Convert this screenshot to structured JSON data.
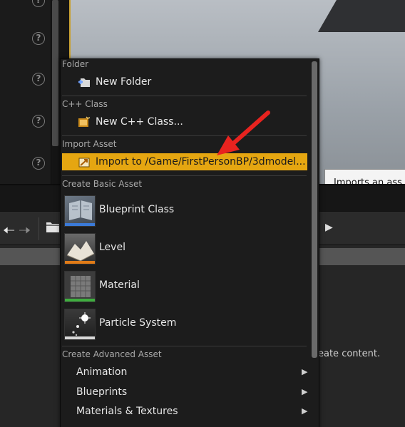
{
  "context_menu": {
    "sections": [
      {
        "header": "Folder",
        "items": [
          {
            "label": "New Folder",
            "icon": "new-folder-icon"
          }
        ]
      },
      {
        "header": "C++ Class",
        "items": [
          {
            "label": "New C++ Class...",
            "icon": "cpp-class-icon"
          }
        ]
      },
      {
        "header": "Import Asset",
        "items": [
          {
            "label": "Import to /Game/FirstPersonBP/3dmodel...",
            "icon": "import-icon",
            "highlighted": true
          }
        ]
      },
      {
        "header": "Create Basic Asset",
        "items": [
          {
            "label": "Blueprint Class",
            "icon": "blueprint-thumbnail",
            "accent": "#3b7ad8"
          },
          {
            "label": "Level",
            "icon": "level-thumbnail",
            "accent": "#e07b17"
          },
          {
            "label": "Material",
            "icon": "material-thumbnail",
            "accent": "#3fae3f"
          },
          {
            "label": "Particle System",
            "icon": "particle-thumbnail",
            "accent": "#d8d8d8"
          }
        ]
      },
      {
        "header": "Create Advanced Asset",
        "items": [
          {
            "label": "Animation",
            "submenu": true
          },
          {
            "label": "Blueprints",
            "submenu": true
          },
          {
            "label": "Materials & Textures",
            "submenu": true
          }
        ]
      }
    ]
  },
  "tooltip": {
    "text": "Imports an ass"
  },
  "content_browser": {
    "hint_text": "eate content."
  },
  "colors": {
    "highlight": "#e5a611",
    "menu_bg": "#1c1c1c",
    "annotation_arrow": "#e8231f"
  }
}
